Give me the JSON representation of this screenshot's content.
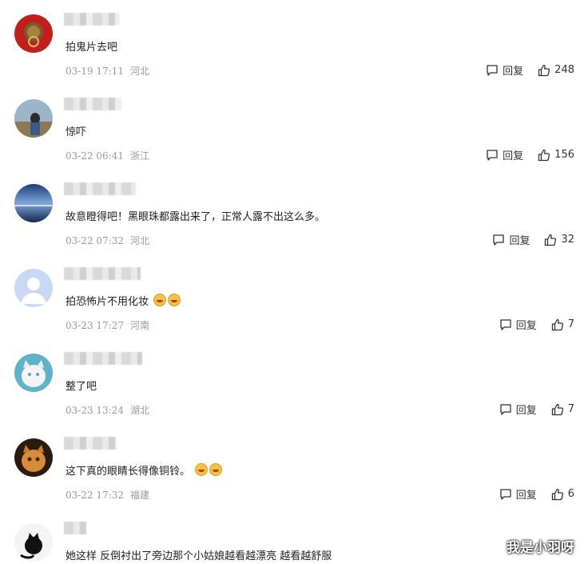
{
  "actions": {
    "reply_label": "回复"
  },
  "comments": [
    {
      "text": "拍鬼片去吧",
      "time": "03-19 17:11",
      "location": "河北",
      "likes": "248"
    },
    {
      "text": "惊吓",
      "time": "03-22 06:41",
      "location": "浙江",
      "likes": "156"
    },
    {
      "text": "故意瞪得吧！黑眼珠都露出来了，正常人露不出这么多。",
      "time": "03-22 07:32",
      "location": "河北",
      "likes": "32"
    },
    {
      "text": "拍恐怖片不用化妆",
      "time": "03-23 17:27",
      "location": "河南",
      "likes": "7"
    },
    {
      "text": "整了吧",
      "time": "03-23 13:24",
      "location": "湖北",
      "likes": "7"
    },
    {
      "text": "这下真的眼睛长得像铜铃。",
      "time": "03-22 17:32",
      "location": "福建",
      "likes": "6"
    },
    {
      "text": "她这样 反倒衬出了旁边那个小姑娘越看越漂亮 越看越舒服"
    }
  ],
  "watermark": "我是小羽呀"
}
